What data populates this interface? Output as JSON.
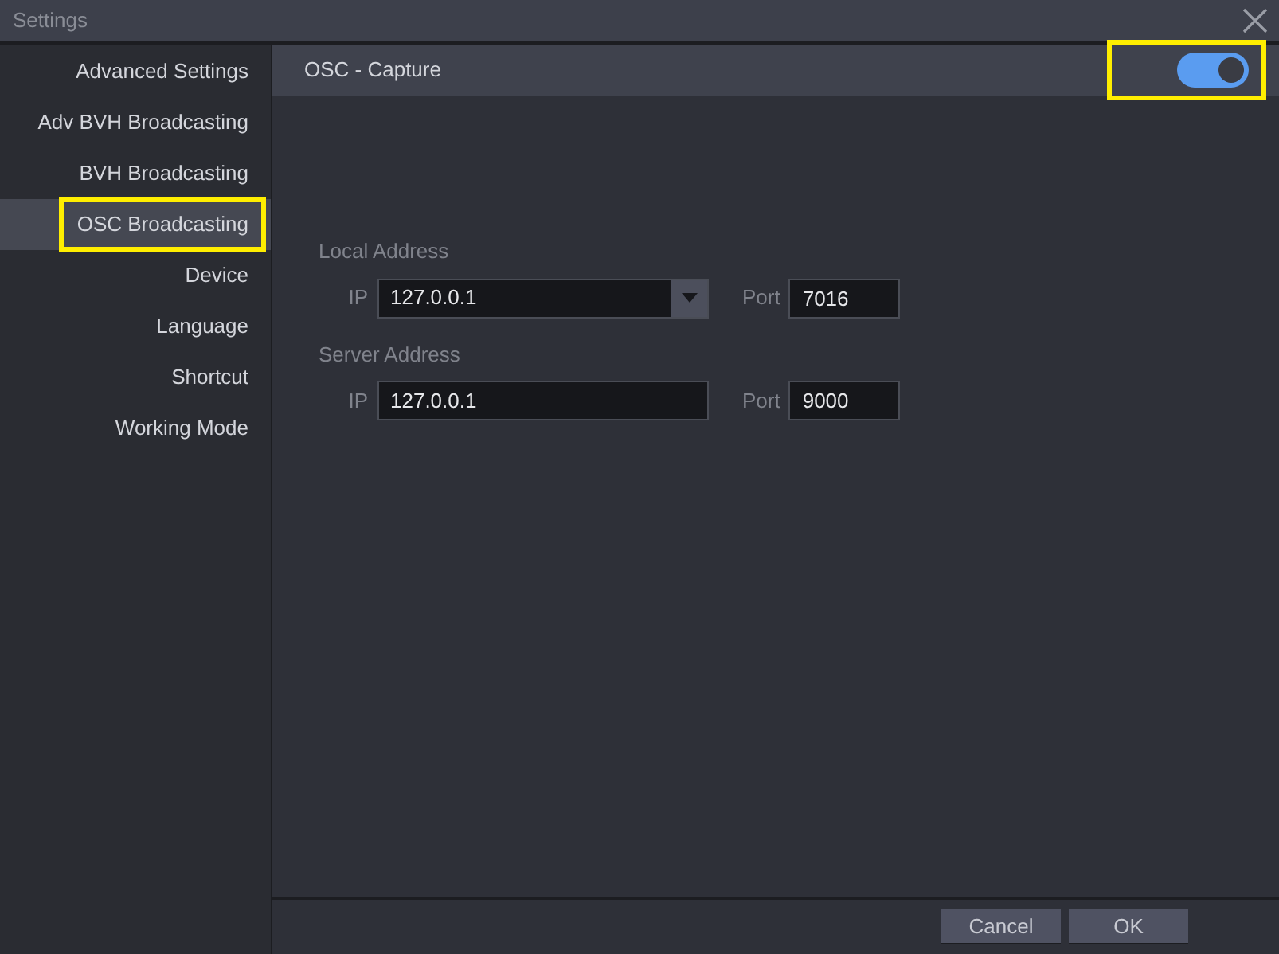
{
  "window": {
    "title": "Settings"
  },
  "sidebar": {
    "items": [
      {
        "label": "Advanced Settings",
        "selected": false,
        "highlighted": false
      },
      {
        "label": "Adv BVH Broadcasting",
        "selected": false,
        "highlighted": false
      },
      {
        "label": "BVH Broadcasting",
        "selected": false,
        "highlighted": false
      },
      {
        "label": "OSC Broadcasting",
        "selected": true,
        "highlighted": true
      },
      {
        "label": "Device",
        "selected": false,
        "highlighted": false
      },
      {
        "label": "Language",
        "selected": false,
        "highlighted": false
      },
      {
        "label": "Shortcut",
        "selected": false,
        "highlighted": false
      },
      {
        "label": "Working Mode",
        "selected": false,
        "highlighted": false
      }
    ]
  },
  "panel": {
    "title": "OSC - Capture",
    "toggle": {
      "on": true,
      "highlighted": true
    },
    "groups": [
      {
        "title": "Local Address",
        "ip_label": "IP",
        "ip": "127.0.0.1",
        "kind": "dropdown",
        "port_label": "Port",
        "port": "7016"
      },
      {
        "title": "Server Address",
        "ip_label": "IP",
        "ip": "127.0.0.1",
        "kind": "text",
        "port_label": "Port",
        "port": "9000"
      }
    ]
  },
  "buttons": [
    "Cancel",
    "OK"
  ]
}
